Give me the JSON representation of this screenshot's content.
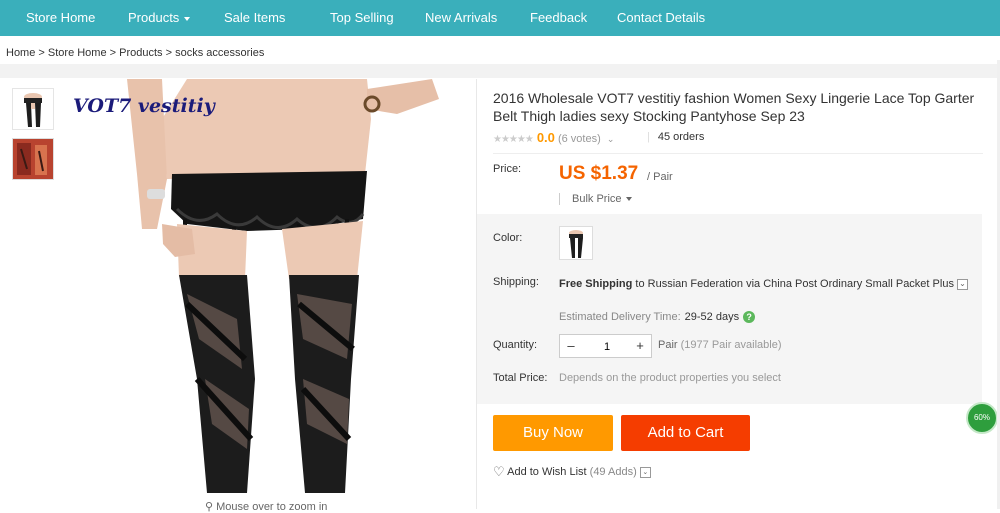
{
  "nav": {
    "items": [
      "Store Home",
      "Products",
      "Sale Items",
      "Top Selling",
      "New Arrivals",
      "Feedback",
      "Contact Details"
    ]
  },
  "breadcrumb": [
    "Home",
    "Store Home",
    "Products",
    "socks accessories"
  ],
  "gallery": {
    "brand_text": "VOT7 vestitiy",
    "zoom_hint": "Mouse over to zoom in"
  },
  "product": {
    "title": "2016 Wholesale VOT7 vestitiy fashion Women Sexy Lingerie Lace Top Garter Belt Thigh ladies sexy Stocking Pantyhose Sep 23",
    "rating_score": "0.0",
    "votes": "(6 votes)",
    "orders": "45 orders",
    "price_label": "Price:",
    "price": "US $1.37",
    "price_unit": "/ Pair",
    "bulk_price": "Bulk Price",
    "color_label": "Color:",
    "shipping_label": "Shipping:",
    "shipping_bold": "Free Shipping",
    "shipping_rest": "to Russian Federation via China Post Ordinary Small Packet Plus",
    "delivery_label": "Estimated Delivery Time:",
    "delivery_days": "29-52 days",
    "quantity_label": "Quantity:",
    "quantity_value": "1",
    "qty_unit": "Pair",
    "qty_available": "(1977 Pair available)",
    "total_label": "Total Price:",
    "total_note": "Depends on the product properties you select",
    "buy_now": "Buy Now",
    "add_to_cart": "Add to Cart",
    "wish_label": "Add to Wish List",
    "wish_count": "(49 Adds)"
  },
  "badge": "60%",
  "colors": {
    "nav": "#3aafbb",
    "price": "#f56400",
    "buy_now": "#ff9900",
    "add_to_cart": "#f53d00"
  }
}
